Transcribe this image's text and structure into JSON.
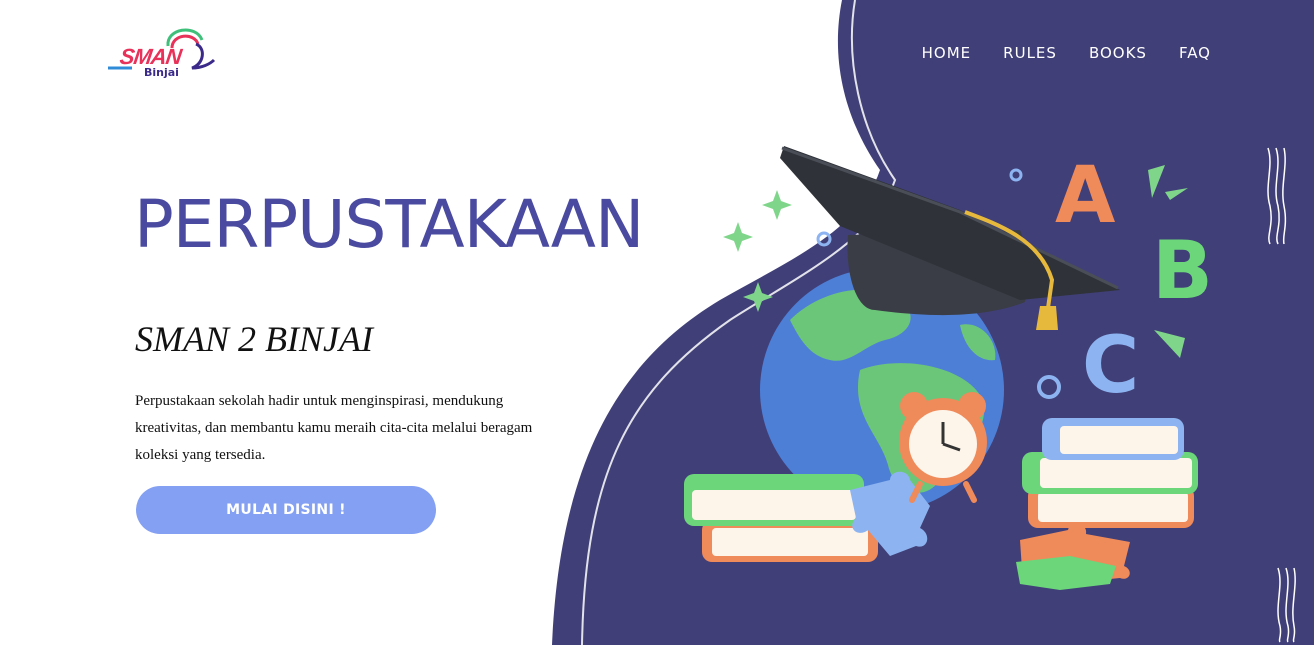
{
  "logo": {
    "text_main": "SMAN",
    "text_sub": "Binjai"
  },
  "nav": {
    "items": [
      {
        "label": "HOME"
      },
      {
        "label": "RULES"
      },
      {
        "label": "BOOKS"
      },
      {
        "label": "FAQ"
      }
    ]
  },
  "hero": {
    "title": "PERPUSTAKAAN",
    "subtitle": "SMAN 2 BINJAI",
    "description": "Perpustakaan sekolah hadir untuk menginspirasi, mendukung kreativitas, dan membantu kamu meraih cita-cita melalui beragam koleksi yang tersedia.",
    "cta_label": "MULAI DISINI !"
  },
  "illustration": {
    "letters": [
      "A",
      "B",
      "C"
    ]
  },
  "colors": {
    "brand_navy": "#403f78",
    "title_purple": "#4a4aa0",
    "cta_blue": "#84a0f2",
    "logo_pink": "#e8325a"
  },
  "icons": [
    "graduation-cap-icon",
    "globe-icon",
    "alarm-clock-icon",
    "books-icon",
    "puzzle-piece-icon",
    "sparkle-icon"
  ]
}
